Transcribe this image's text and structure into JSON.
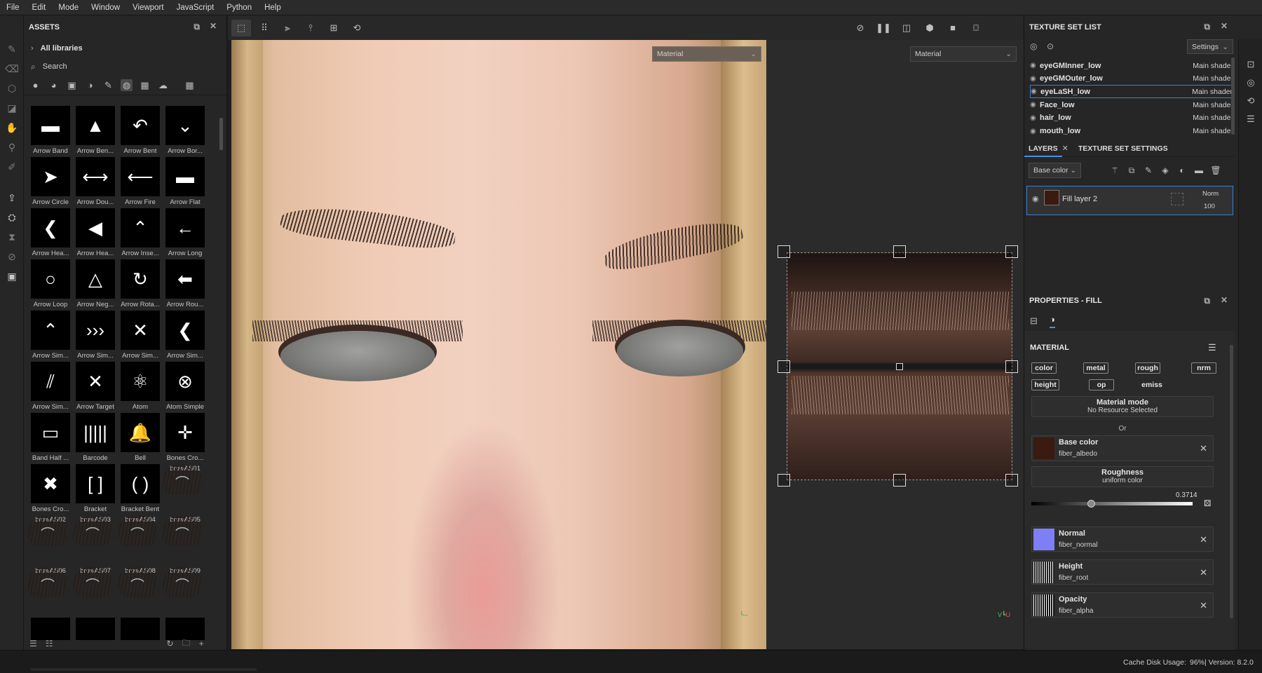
{
  "menu": [
    "File",
    "Edit",
    "Mode",
    "Window",
    "Viewport",
    "JavaScript",
    "Python",
    "Help"
  ],
  "assets": {
    "title": "ASSETS",
    "library": "All libraries",
    "search_placeholder": "Search",
    "items": [
      {
        "label": "Arrow Band",
        "glyph": "▬"
      },
      {
        "label": "Arrow Ben...",
        "glyph": "▲"
      },
      {
        "label": "Arrow Bent",
        "glyph": "↶"
      },
      {
        "label": "Arrow Bor...",
        "glyph": "⌄"
      },
      {
        "label": "Arrow Circle",
        "glyph": "➤"
      },
      {
        "label": "Arrow Dou...",
        "glyph": "⟷"
      },
      {
        "label": "Arrow Fire",
        "glyph": "⟵"
      },
      {
        "label": "Arrow Flat",
        "glyph": "▬"
      },
      {
        "label": "Arrow Hea...",
        "glyph": "❮"
      },
      {
        "label": "Arrow Hea...",
        "glyph": "◀"
      },
      {
        "label": "Arrow Inse...",
        "glyph": "⌃"
      },
      {
        "label": "Arrow Long",
        "glyph": "←"
      },
      {
        "label": "Arrow Loop",
        "glyph": "○"
      },
      {
        "label": "Arrow Neg...",
        "glyph": "△"
      },
      {
        "label": "Arrow Rota...",
        "glyph": "↻"
      },
      {
        "label": "Arrow Rou...",
        "glyph": "⬅"
      },
      {
        "label": "Arrow Sim...",
        "glyph": "⌃"
      },
      {
        "label": "Arrow Sim...",
        "glyph": "›››"
      },
      {
        "label": "Arrow Sim...",
        "glyph": "✕"
      },
      {
        "label": "Arrow Sim...",
        "glyph": "❮"
      },
      {
        "label": "Arrow Sim...",
        "glyph": "⫽"
      },
      {
        "label": "Arrow Target",
        "glyph": "✕"
      },
      {
        "label": "Atom",
        "glyph": "⚛"
      },
      {
        "label": "Atom Simple",
        "glyph": "⊗"
      },
      {
        "label": "Band Half ...",
        "glyph": "▭"
      },
      {
        "label": "Barcode",
        "glyph": "|||||"
      },
      {
        "label": "Bell",
        "glyph": "🔔"
      },
      {
        "label": "Bones Cro...",
        "glyph": "✛"
      },
      {
        "label": "Bones Cro...",
        "glyph": "✖"
      },
      {
        "label": "Bracket",
        "glyph": "[ ]"
      },
      {
        "label": "Bracket Bent",
        "glyph": "( )"
      },
      {
        "label": "browAS01",
        "glyph": "⌒"
      },
      {
        "label": "browAS02",
        "glyph": "⌒"
      },
      {
        "label": "browAS03",
        "glyph": "⌒"
      },
      {
        "label": "browAS04",
        "glyph": "⌒"
      },
      {
        "label": "browAS05",
        "glyph": "⌒"
      },
      {
        "label": "browAS06",
        "glyph": "⌒"
      },
      {
        "label": "browAS07",
        "glyph": "⌒"
      },
      {
        "label": "browAS08",
        "glyph": "⌒"
      },
      {
        "label": "browAS09",
        "glyph": "⌒"
      },
      {
        "label": "",
        "glyph": ""
      },
      {
        "label": "",
        "glyph": ""
      },
      {
        "label": "",
        "glyph": ""
      },
      {
        "label": "",
        "glyph": ""
      }
    ]
  },
  "viewport": {
    "left_mode": "Material",
    "right_mode": "Material",
    "axis_v": "V",
    "axis_u": "U"
  },
  "texture_set_list": {
    "title": "TEXTURE SET LIST",
    "settings_label": "Settings",
    "rows": [
      {
        "name": "eyeGMInner_low",
        "shader": "Main shader"
      },
      {
        "name": "eyeGMOuter_low",
        "shader": "Main shader"
      },
      {
        "name": "eyeLaSH_low",
        "shader": "Main shader"
      },
      {
        "name": "Face_low",
        "shader": "Main shader"
      },
      {
        "name": "hair_low",
        "shader": "Main shader"
      },
      {
        "name": "mouth_low",
        "shader": "Main shader"
      }
    ]
  },
  "layers": {
    "tab_layers": "LAYERS",
    "tab_settings": "TEXTURE SET SETTINGS",
    "channel": "Base color",
    "layer_name": "Fill layer 2",
    "blend": "Norm",
    "opacity": "100"
  },
  "properties": {
    "title": "PROPERTIES - FILL",
    "section": "MATERIAL",
    "chips": [
      "color",
      "metal",
      "rough",
      "nrm",
      "height",
      "op",
      "emiss"
    ],
    "material_mode_title": "Material mode",
    "material_mode_value": "No Resource Selected",
    "or": "Or",
    "base_color_title": "Base color",
    "base_color_value": "fiber_albedo",
    "roughness_title": "Roughness",
    "roughness_value": "uniform color",
    "roughness_number": "0.3714",
    "roughness_fraction": 0.3714,
    "normal_title": "Normal",
    "normal_value": "fiber_normal",
    "height_title": "Height",
    "height_value": "fiber_root",
    "opacity_title": "Opacity",
    "opacity_value": "fiber_alpha"
  },
  "status": {
    "cache": "Cache Disk Usage:",
    "cache_value": "96%",
    "version": "| Version: 8.2.0"
  },
  "colors": {
    "accent": "#3a7fd1",
    "base_color_swatch": "#3b1a10",
    "normal_swatch": "#7f7ff5"
  }
}
